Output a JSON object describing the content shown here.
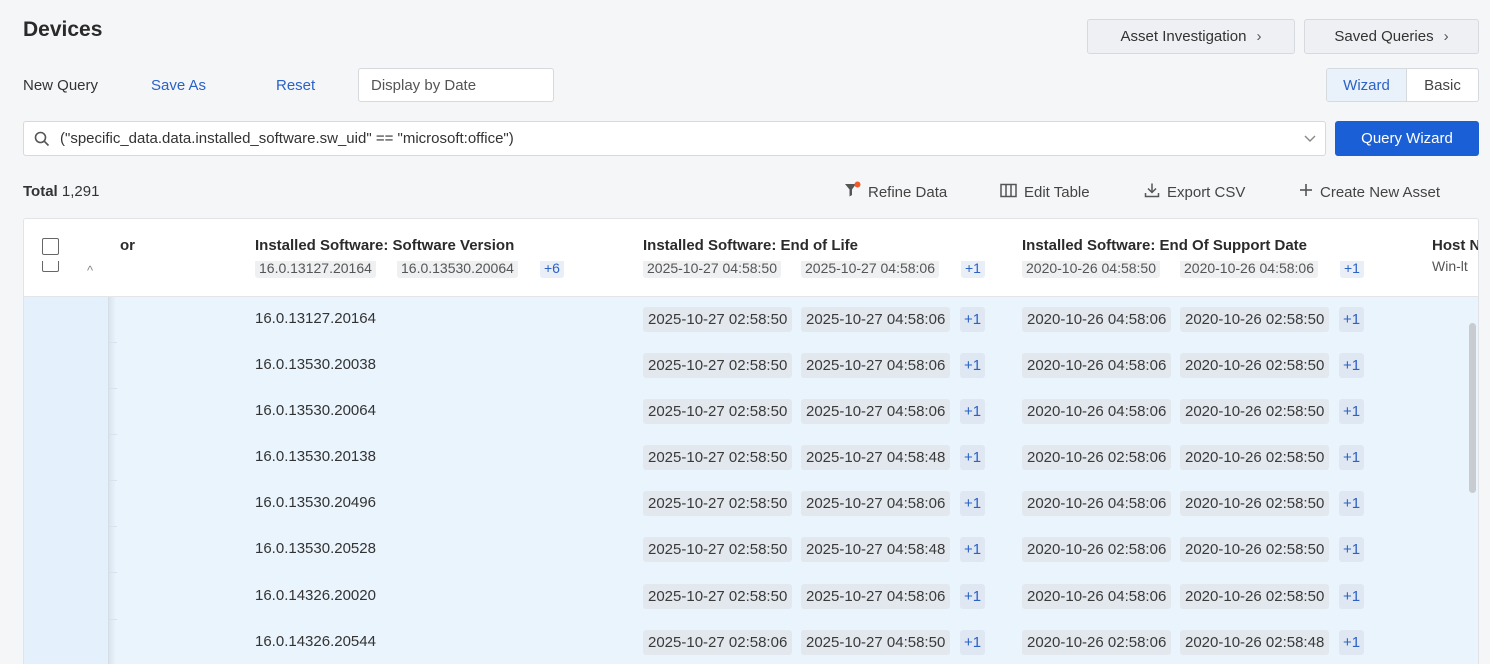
{
  "page": {
    "title": "Devices"
  },
  "top_buttons": {
    "asset_investigation": "Asset Investigation",
    "saved_queries": "Saved Queries"
  },
  "query_bar": {
    "new_query": "New Query",
    "save_as": "Save As",
    "reset": "Reset",
    "display_by_date_placeholder": "Display by Date",
    "mode_wizard": "Wizard",
    "mode_basic": "Basic",
    "active_mode": "Wizard"
  },
  "search": {
    "query": "(\"specific_data.data.installed_software.sw_uid\" == \"microsoft:office\")",
    "query_wizard_button": "Query Wizard"
  },
  "summary": {
    "total_label": "Total",
    "total_value": "1,291"
  },
  "actions": {
    "refine_data": "Refine Data",
    "edit_table": "Edit Table",
    "export_csv": "Export CSV",
    "create_new_asset": "Create New Asset"
  },
  "table": {
    "columns": {
      "partial_left": "or",
      "software_version": "Installed Software: Software Version",
      "end_of_life": "Installed Software: End of Life",
      "end_of_support": "Installed Software: End Of Support Date",
      "host_partial": "Host N"
    },
    "expanded_row": {
      "versions": [
        "16.0.13127.20164",
        "16.0.13530.20064"
      ],
      "versions_more": "+6",
      "eol": [
        "2025-10-27 04:58:50",
        "2025-10-27 04:58:06"
      ],
      "eol_more": "+1",
      "eos": [
        "2020-10-26 04:58:50",
        "2020-10-26 04:58:06"
      ],
      "eos_more": "+1",
      "host": "Win-lt"
    },
    "rows": [
      {
        "version": "16.0.13127.20164",
        "eol1": "2025-10-27 02:58:50",
        "eol2": "2025-10-27 04:58:06",
        "eol_more": "+1",
        "eos1": "2020-10-26 04:58:06",
        "eos2": "2020-10-26 02:58:50",
        "eos_more": "+1"
      },
      {
        "version": "16.0.13530.20038",
        "eol1": "2025-10-27 02:58:50",
        "eol2": "2025-10-27 04:58:06",
        "eol_more": "+1",
        "eos1": "2020-10-26 04:58:06",
        "eos2": "2020-10-26 02:58:50",
        "eos_more": "+1"
      },
      {
        "version": "16.0.13530.20064",
        "eol1": "2025-10-27 02:58:50",
        "eol2": "2025-10-27 04:58:06",
        "eol_more": "+1",
        "eos1": "2020-10-26 04:58:06",
        "eos2": "2020-10-26 02:58:50",
        "eos_more": "+1"
      },
      {
        "version": "16.0.13530.20138",
        "eol1": "2025-10-27 02:58:50",
        "eol2": "2025-10-27 04:58:48",
        "eol_more": "+1",
        "eos1": "2020-10-26 02:58:06",
        "eos2": "2020-10-26 02:58:50",
        "eos_more": "+1"
      },
      {
        "version": "16.0.13530.20496",
        "eol1": "2025-10-27 02:58:50",
        "eol2": "2025-10-27 04:58:06",
        "eol_more": "+1",
        "eos1": "2020-10-26 04:58:06",
        "eos2": "2020-10-26 02:58:50",
        "eos_more": "+1"
      },
      {
        "version": "16.0.13530.20528",
        "eol1": "2025-10-27 02:58:50",
        "eol2": "2025-10-27 04:58:48",
        "eol_more": "+1",
        "eos1": "2020-10-26 02:58:06",
        "eos2": "2020-10-26 02:58:50",
        "eos_more": "+1"
      },
      {
        "version": "16.0.14326.20020",
        "eol1": "2025-10-27 02:58:50",
        "eol2": "2025-10-27 04:58:06",
        "eol_more": "+1",
        "eos1": "2020-10-26 04:58:06",
        "eos2": "2020-10-26 02:58:50",
        "eos_more": "+1"
      },
      {
        "version": "16.0.14326.20544",
        "eol1": "2025-10-27 02:58:06",
        "eol2": "2025-10-27 04:58:50",
        "eol_more": "+1",
        "eos1": "2020-10-26 02:58:06",
        "eos2": "2020-10-26 02:58:48",
        "eos_more": "+1"
      }
    ]
  },
  "colors": {
    "primary": "#1b5fd6",
    "link": "#2a62c6",
    "selected_row_bg": "#eaf4fd",
    "refine_badge": "#f05a28"
  }
}
